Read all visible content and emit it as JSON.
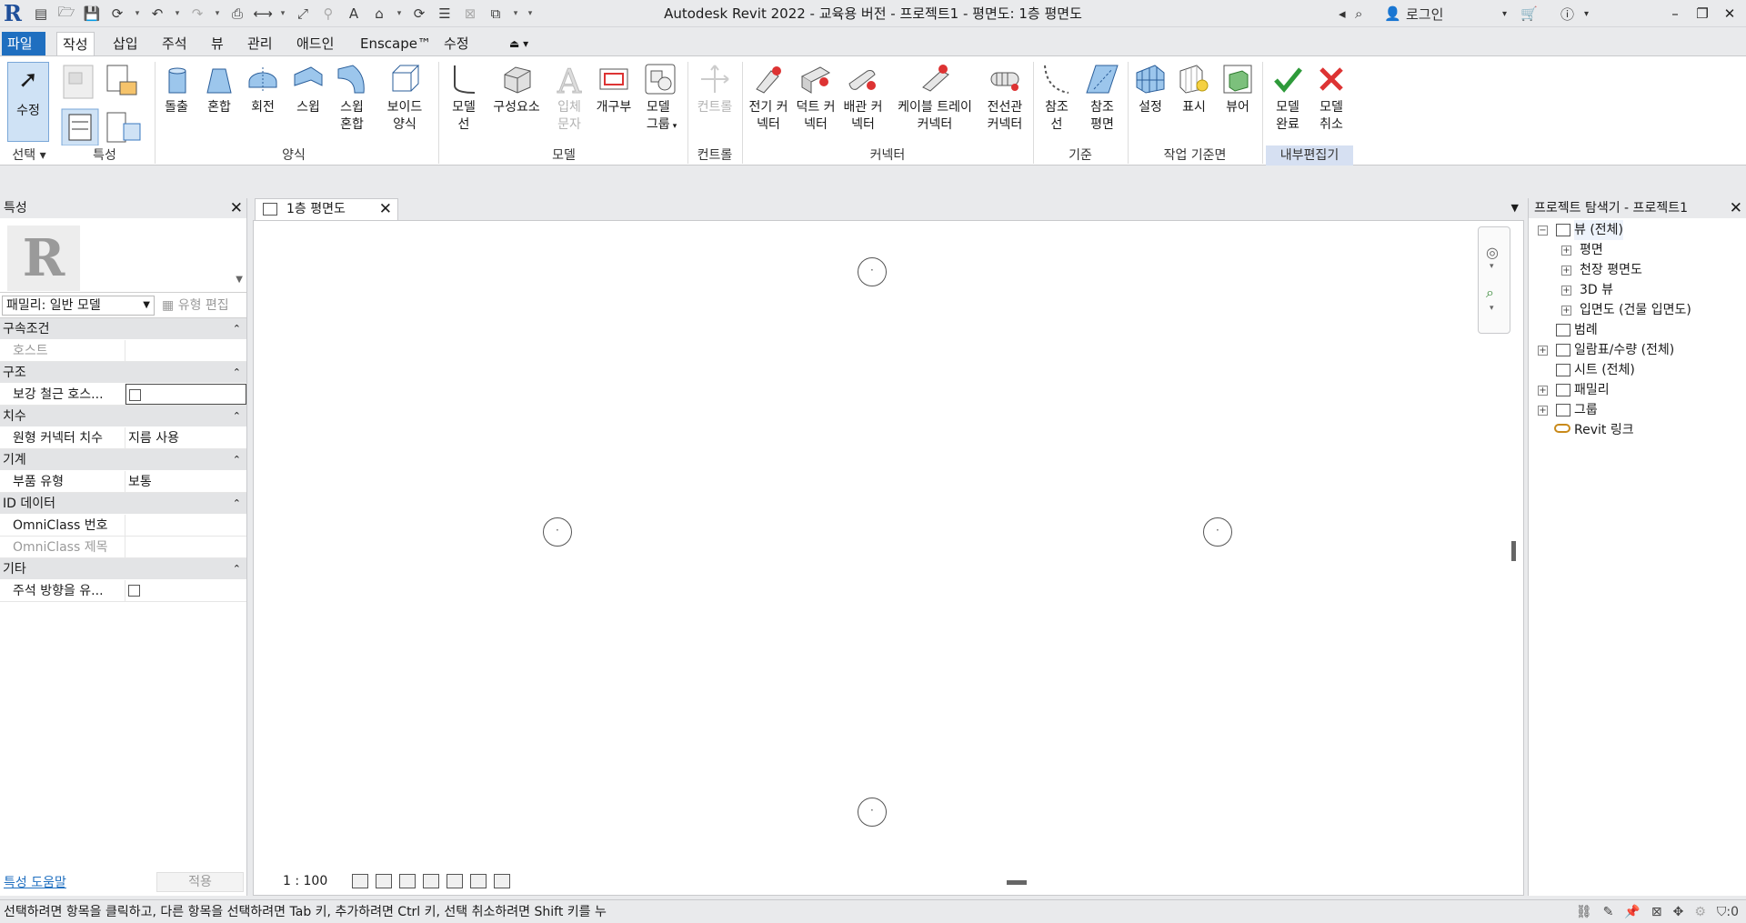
{
  "window": {
    "title": "Autodesk Revit 2022 - 교육용 버전 - 프로젝트1 - 평면도: 1층 평면도",
    "login_label": "로그인"
  },
  "ribbon_tabs": [
    "파일",
    "작성",
    "삽입",
    "주석",
    "뷰",
    "관리",
    "애드인",
    "Enscape™",
    "수정"
  ],
  "ribbon": {
    "select_panel": {
      "modify_label": "수정",
      "panel_label": "선택"
    },
    "properties_panel": {
      "panel_label": "특성"
    },
    "forms_panel": {
      "buttons": [
        "돌출",
        "혼합",
        "회전",
        "스윕",
        "스윕 혼합",
        "보이드 양식"
      ],
      "panel_label": "양식"
    },
    "model_panel": {
      "buttons": [
        "모델 선",
        "구성요소",
        "입체 문자",
        "개구부",
        "모델 그룹"
      ],
      "panel_label": "모델"
    },
    "control_panel": {
      "button": "컨트롤",
      "panel_label": "컨트롤"
    },
    "connectors_panel": {
      "buttons": [
        "전기 커넥터",
        "덕트 커넥터",
        "배관 커넥터",
        "케이블 트레이 커넥터",
        "전선관 커넥터"
      ],
      "panel_label": "커넥터"
    },
    "datum_panel": {
      "buttons": [
        "참조 선",
        "참조 평면"
      ],
      "panel_label": "기준"
    },
    "workplane_panel": {
      "buttons": [
        "설정",
        "표시",
        "뷰어"
      ],
      "panel_label": "작업 기준면"
    },
    "inplace_panel": {
      "buttons": [
        "모델 완료",
        "모델 취소"
      ],
      "panel_label": "내부편집기"
    }
  },
  "properties": {
    "title": "특성",
    "family_selector": "패밀리: 일반 모델",
    "edit_type": "유형 편집",
    "groups": [
      {
        "name": "구속조건",
        "rows": [
          {
            "key": "호스트",
            "value": ""
          }
        ]
      },
      {
        "name": "구조",
        "rows": [
          {
            "key": "보강 철근 호스...",
            "value": ""
          }
        ]
      },
      {
        "name": "치수",
        "rows": [
          {
            "key": "원형 커넥터 치수",
            "value": "지름 사용"
          }
        ]
      },
      {
        "name": "기계",
        "rows": [
          {
            "key": "부품 유형",
            "value": "보통"
          }
        ]
      },
      {
        "name": "ID 데이터",
        "rows": [
          {
            "key": "OmniClass 번호",
            "value": ""
          },
          {
            "key": "OmniClass 제목",
            "value": ""
          }
        ]
      },
      {
        "name": "기타",
        "rows": [
          {
            "key": "주석 방향을 유...",
            "value": ""
          }
        ]
      }
    ],
    "help_link": "특성 도움말",
    "apply_button": "적용"
  },
  "view": {
    "tab_label": "1층 평면도",
    "scale": "1 : 100"
  },
  "project_browser": {
    "title": "프로젝트 탐색기 - 프로젝트1",
    "nodes": {
      "views": "뷰 (전체)",
      "floor_plans": "평면",
      "ceiling_plans": "천장 평면도",
      "views_3d": "3D 뷰",
      "elevations": "입면도 (건물 입면도)",
      "legends": "범례",
      "schedules": "일람표/수량 (전체)",
      "sheets": "시트 (전체)",
      "families": "패밀리",
      "groups": "그룹",
      "revit_links": "Revit 링크"
    }
  },
  "status": {
    "message": "선택하려면 항목을 클릭하고, 다른 항목을 선택하려면 Tab 키, 추가하려면 Ctrl 키, 선택 취소하려면 Shift 키를 누",
    "filter_count": ":0"
  }
}
